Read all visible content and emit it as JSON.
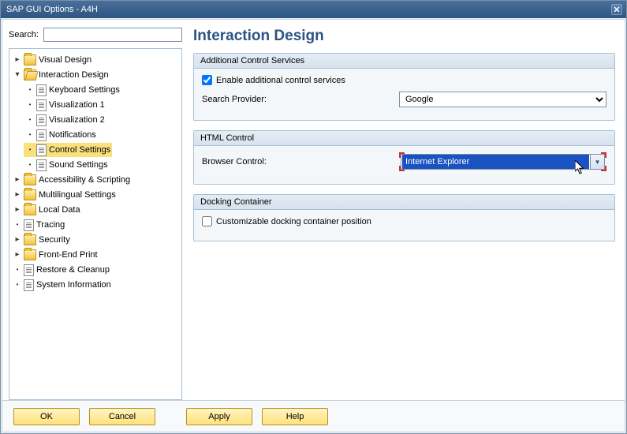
{
  "window": {
    "title": "SAP GUI Options - A4H"
  },
  "search": {
    "label": "Search:",
    "value": ""
  },
  "tree": {
    "items": [
      {
        "label": "Visual Design",
        "type": "folder",
        "exp": "▸"
      },
      {
        "label": "Interaction Design",
        "type": "folder-open",
        "exp": "▾",
        "children": [
          {
            "label": "Keyboard Settings",
            "type": "page"
          },
          {
            "label": "Visualization 1",
            "type": "page"
          },
          {
            "label": "Visualization 2",
            "type": "page"
          },
          {
            "label": "Notifications",
            "type": "page"
          },
          {
            "label": "Control Settings",
            "type": "page",
            "selected": true
          },
          {
            "label": "Sound Settings",
            "type": "page"
          }
        ]
      },
      {
        "label": "Accessibility & Scripting",
        "type": "folder",
        "exp": "▸"
      },
      {
        "label": "Multilingual Settings",
        "type": "folder",
        "exp": "▸"
      },
      {
        "label": "Local Data",
        "type": "folder",
        "exp": "▸"
      },
      {
        "label": "Tracing",
        "type": "page"
      },
      {
        "label": "Security",
        "type": "folder",
        "exp": "▸"
      },
      {
        "label": "Front-End Print",
        "type": "folder",
        "exp": "▸"
      },
      {
        "label": "Restore & Cleanup",
        "type": "page"
      },
      {
        "label": "System Information",
        "type": "page"
      }
    ]
  },
  "page": {
    "title": "Interaction Design",
    "groups": {
      "acs": {
        "title": "Additional Control Services",
        "enable_label": "Enable additional control services",
        "enable_checked": true,
        "provider_label": "Search Provider:",
        "provider_value": "Google"
      },
      "html": {
        "title": "HTML Control",
        "browser_label": "Browser Control:",
        "browser_value": "Internet Explorer"
      },
      "dock": {
        "title": "Docking Container",
        "custom_label": "Customizable docking container position",
        "custom_checked": false
      }
    }
  },
  "buttons": {
    "ok": "OK",
    "cancel": "Cancel",
    "apply": "Apply",
    "help": "Help"
  }
}
